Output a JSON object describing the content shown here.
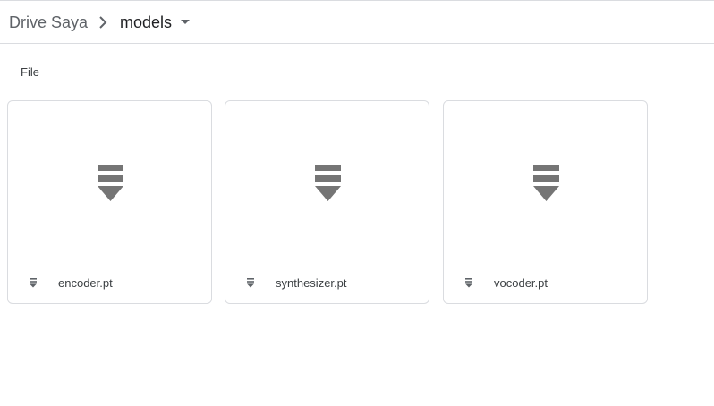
{
  "breadcrumb": {
    "root": "Drive Saya",
    "current": "models",
    "separator_icon": "chevron-right-icon",
    "dropdown_icon": "caret-down-icon"
  },
  "section": {
    "label": "File"
  },
  "files": [
    {
      "name": "encoder.pt",
      "icon": "download-file-icon"
    },
    {
      "name": "synthesizer.pt",
      "icon": "download-file-icon"
    },
    {
      "name": "vocoder.pt",
      "icon": "download-file-icon"
    }
  ],
  "colors": {
    "border": "#dadce0",
    "icon": "#757575",
    "text_primary": "#202124",
    "text_secondary": "#5f6368"
  }
}
